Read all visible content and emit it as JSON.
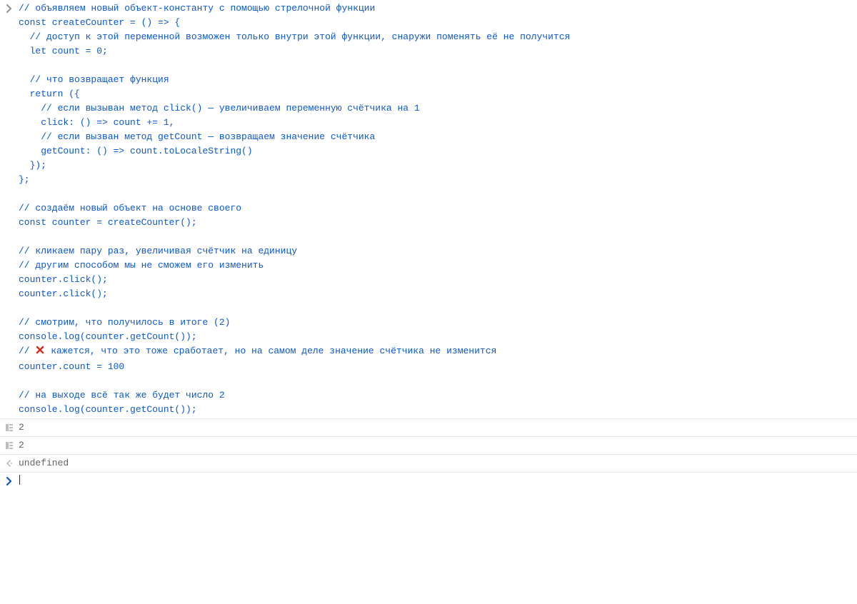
{
  "code": {
    "l01": "// объявляем новый объект-константу с помощью стрелочной функции",
    "l02": "const createCounter = () => {",
    "l03": "  // доступ к этой переменной возможен только внутри этой функции, снаружи поменять её не получится",
    "l04": "  let count = 0;",
    "l05": "",
    "l06": "  // что возвращает функция",
    "l07": "  return ({",
    "l08": "    // если вызыван метод click() — увеличиваем переменную счётчика на 1",
    "l09": "    click: () => count += 1,",
    "l10": "    // если вызван метод getCount — возвращаем значение счётчика",
    "l11": "    getCount: () => count.toLocaleString()",
    "l12": "  });",
    "l13": "};",
    "l14": "",
    "l15": "// создаём новый объект на основе своего",
    "l16": "const counter = createCounter();",
    "l17": "",
    "l18": "// кликаем пару раз, увеличивая счётчик на единицу",
    "l19": "// другим способом мы не сможем его изменить",
    "l20": "counter.click();",
    "l21": "counter.click();",
    "l22": "",
    "l23": "// смотрим, что получилось в итоге (2)",
    "l24": "console.log(counter.getCount());",
    "l25a": "// ",
    "l25b": " кажется, что это тоже сработает, но на самом деле значение счётчика не изменится",
    "l26": "counter.count = 100",
    "l27": "",
    "l28": "// на выходе всё так же будет число 2",
    "l29": "console.log(counter.getCount());"
  },
  "output": {
    "log1": "2",
    "log2": "2",
    "ret": "undefined"
  },
  "prompt": {
    "chevron": "›"
  }
}
